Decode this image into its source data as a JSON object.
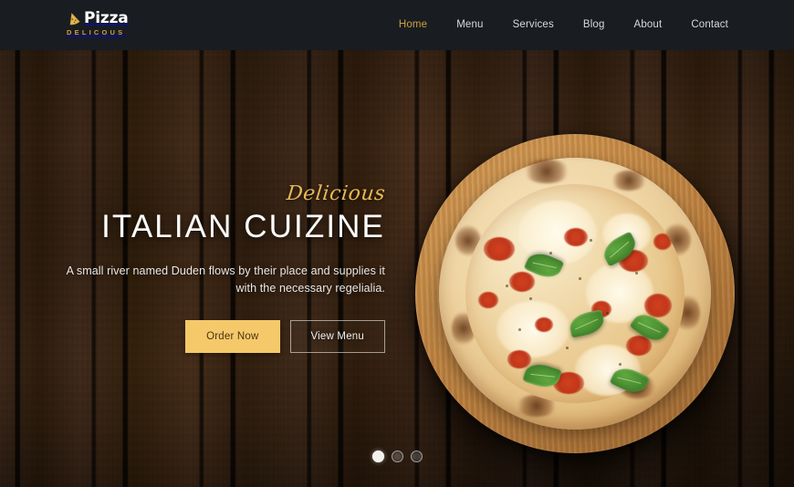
{
  "site": {
    "brand_name": "Pizza",
    "brand_tagline": "DELICOUS",
    "brand_icon": "pizza-slice-icon",
    "accent_gold": "#c9a23c",
    "button_gold": "#f5c96a",
    "header_bg": "#191c20"
  },
  "nav": {
    "items": [
      {
        "label": "Home",
        "active": true
      },
      {
        "label": "Menu",
        "active": false
      },
      {
        "label": "Services",
        "active": false
      },
      {
        "label": "Blog",
        "active": false
      },
      {
        "label": "About",
        "active": false
      },
      {
        "label": "Contact",
        "active": false
      }
    ]
  },
  "hero": {
    "eyebrow": "Delicious",
    "headline": "ITALIAN CUIZINE",
    "lede": "A small river named Duden flows by their place and supplies it with the necessary regelialia.",
    "primary_cta": "Order Now",
    "secondary_cta": "View Menu",
    "image_alt": "margherita-pizza-on-wooden-board",
    "background_alt": "dark-wood-plank-texture"
  },
  "carousel": {
    "slide_count": 3,
    "active_index": 1,
    "dots": [
      "1",
      "2",
      "3"
    ]
  }
}
